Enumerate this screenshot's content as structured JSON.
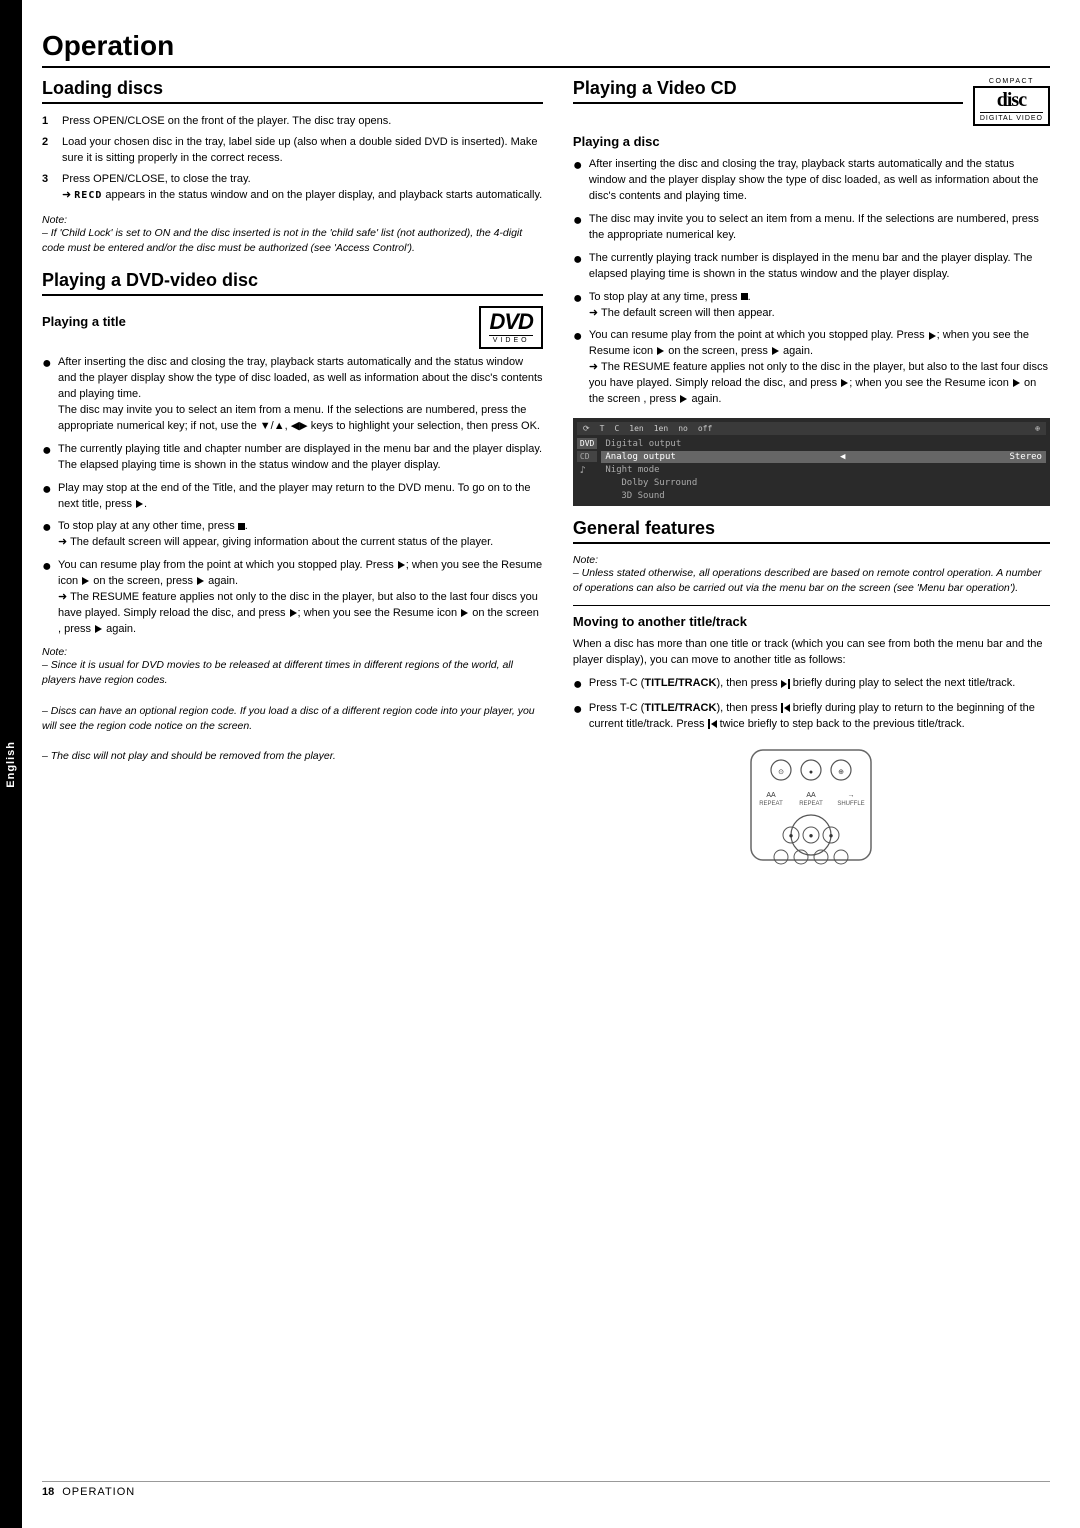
{
  "page": {
    "title": "Operation",
    "sidebar_label": "English",
    "footer_page": "18",
    "footer_section": "Operation"
  },
  "loading_discs": {
    "title": "Loading discs",
    "steps": [
      {
        "num": "1",
        "text": "Press OPEN/CLOSE on the front of the player. The disc tray opens."
      },
      {
        "num": "2",
        "text": "Load your chosen disc in the tray, label side up (also when a double sided DVD is inserted). Make sure it is sitting properly in the correct recess."
      },
      {
        "num": "3",
        "text": "Press OPEN/CLOSE, to close the tray.",
        "sub": "➜ RECD appears in the status window and on the player display, and playback starts automatically."
      }
    ],
    "note_label": "Note:",
    "note_text": "– If 'Child Lock' is set to ON and the disc inserted is not in the 'child safe' list (not authorized), the 4-digit code must be entered and/or the disc must be authorized (see 'Access Control')."
  },
  "dvd_video": {
    "title": "Playing a DVD-video disc",
    "sub_title": "Playing a title",
    "logo_text": "DVD",
    "logo_sub": "VIDEO",
    "bullets": [
      "After inserting the disc and closing the tray, playback starts automatically and the status window and the player display show the type of disc loaded, as well as information about the disc's contents and playing time.\nThe disc may invite you to select an item from a menu. If the selections are numbered, press the appropriate numerical key; if not, use the ▼/▲, ◀▶ keys to highlight your selection, then press OK.",
      "The currently playing title and chapter number are displayed in the menu bar and the player display.\nThe elapsed playing time is shown in the status window and the player display.",
      "Play may stop at the end of the Title, and the player may return to the DVD menu. To go on to the next title, press ▶.",
      "To stop play at any other time, press ■.\n➜ The default screen will appear, giving information about the current status of the player.",
      "You can resume play from the point at which you stopped play. Press ▶; when you see the Resume icon ▶ on the screen, press ▶ again.\n➜ The RESUME feature applies not only to the disc in the player, but also to the last four discs you have played. Simply reload the disc, and press ▶; when you see the Resume icon ▶ on the screen , press ▶ again."
    ],
    "note_label": "Note:",
    "notes": [
      "– Since it is usual for DVD movies to be released at different times in different regions of the world, all players have region codes.",
      "– Discs can have an optional region code. If you load a disc of a different region code into your player, you will see the region code notice on the screen.",
      "– The disc will not play and should be removed from the player."
    ]
  },
  "playing_video_cd": {
    "title": "Playing a Video CD",
    "compact_text": "COMPACT",
    "disc_name": "disc",
    "disc_sub": "DIGITAL VIDEO",
    "sub_title": "Playing a disc",
    "bullets": [
      "After inserting the disc and closing the tray, playback starts automatically and the status window and the player display show the type of disc loaded, as well as information about the disc's contents and playing time.",
      "The disc may invite you to select an item from a menu. If the selections are numbered, press the appropriate numerical key.",
      "The currently playing track number is displayed in the menu bar and the player display. The elapsed playing time is shown in the status window and the player display.",
      "To stop play at any time, press ■.\n➜ The default screen will then appear.",
      "You can resume play from the point at which you stopped play. Press ▶; when you see the Resume icon ▶ on the screen, press ▶ again.\n➜ The RESUME feature applies not only to the disc in the player, but also to the last four discs you have played. Simply reload the disc, and press ▶; when you see the Resume icon ▶ on the screen , press ▶ again."
    ],
    "screen": {
      "top_items": [
        "G",
        "T",
        "C",
        "1en",
        "1en",
        "no",
        "off"
      ],
      "dvd_label": "DVD",
      "row1_label": "Digital output",
      "row2_label": "Analog output",
      "row2_value": "Stereo",
      "row3_label": "Night mode",
      "row3_value": "Dolby Surround",
      "row4_value": "3D Sound"
    }
  },
  "general_features": {
    "title": "General features",
    "note_label": "Note:",
    "note_text": "– Unless stated otherwise, all operations described are based on remote control operation. A number of operations can also be carried out via the menu bar on the screen (see 'Menu bar operation').",
    "moving_title": "Moving to another title/track",
    "moving_text": "When a disc has more than one title or track (which you can see from both the menu bar and the player display), you can move to another title as follows:",
    "bullets": [
      "Press T-C (TITLE/TRACK), then press ▶| briefly during play to select the next title/track.",
      "Press T-C (TITLE/TRACK), then press |◀ briefly during play to return to the beginning of the current title/track. Press |◀ twice briefly to step back to the previous title/track."
    ]
  }
}
